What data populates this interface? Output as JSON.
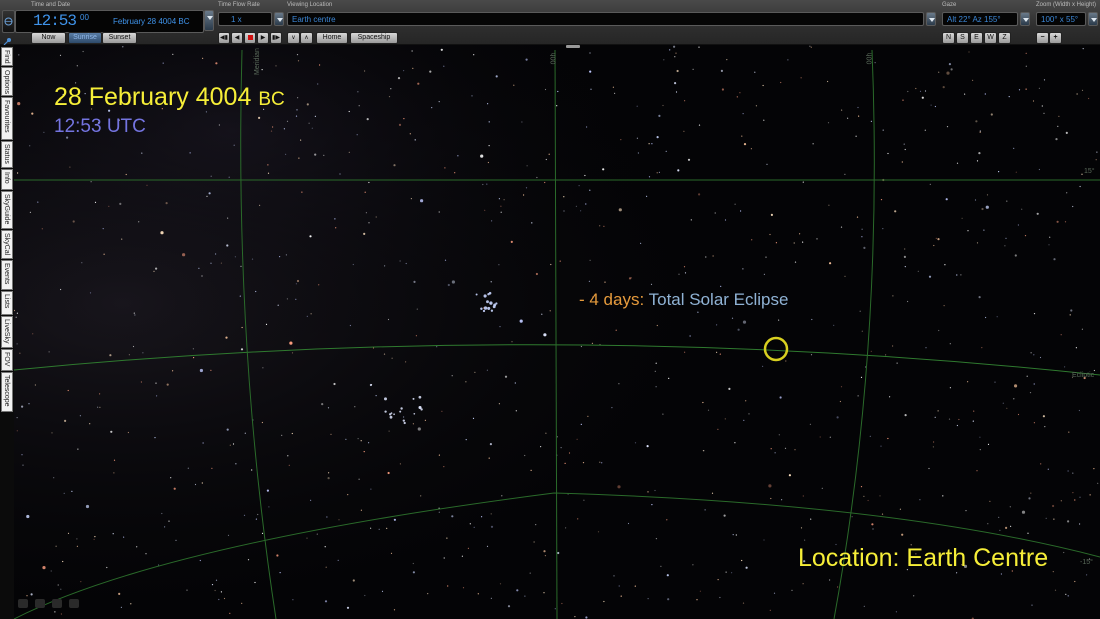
{
  "toolbar": {
    "time_date": {
      "group_label": "Time and Date",
      "time": "12:53",
      "seconds": "00",
      "date": "February 28   4004 BC",
      "now_button": "Now",
      "sunrise_button": "Sunrise",
      "sunset_button": "Sunset"
    },
    "time_flow": {
      "group_label": "Time Flow Rate",
      "rate": "1 x",
      "home_button": "Home",
      "spaceship_button": "Spaceship"
    },
    "viewing_location": {
      "group_label": "Viewing Location",
      "value": "Earth centre"
    },
    "gaze": {
      "group_label": "Gaze",
      "value": "Alt 22° Az 155°",
      "directions": [
        "N",
        "S",
        "E",
        "W",
        "Z"
      ]
    },
    "zoom": {
      "group_label": "Zoom (Width x Height)",
      "value": "100° x 55°",
      "minus": "−",
      "plus": "+"
    }
  },
  "side_tabs": [
    "Find",
    "Options",
    "Favourites",
    "Status",
    "Info",
    "SkyGuide",
    "SkyCal",
    "Events",
    "Lists",
    "LiveSky",
    "FOV",
    "Telescope"
  ],
  "sky": {
    "date_text": "28 February 4004",
    "era_text": "BC",
    "time_text": "12:53 UTC",
    "event_days": "- 4 days:",
    "event_name": "Total Solar Eclipse",
    "location_text": "Location: Earth Centre",
    "grid_labels": {
      "ecliptic": "Ecliptic",
      "dec_top": "15°",
      "dec_bottom": "-15°",
      "meridian": "Meridian",
      "ra_a": "00h",
      "ra_b": "00h"
    }
  },
  "colors": {
    "overlay_yellow": "#f6ee38",
    "utc_purple": "#7474e0",
    "event_orange": "#e59a3c",
    "event_blue": "#8fb2d4",
    "grid_green": "#2f7a2f",
    "sun_marker": "#d8d020",
    "field_text_blue": "#3c87d6"
  },
  "icons": {
    "app_icon": "globe-icon",
    "pin_icon": "pin-icon",
    "transport": [
      "skip-back-icon",
      "step-back-icon",
      "stop-icon",
      "play-icon",
      "skip-forward-icon"
    ],
    "nav": [
      "chevron-down-icon",
      "chevron-up-icon"
    ]
  }
}
